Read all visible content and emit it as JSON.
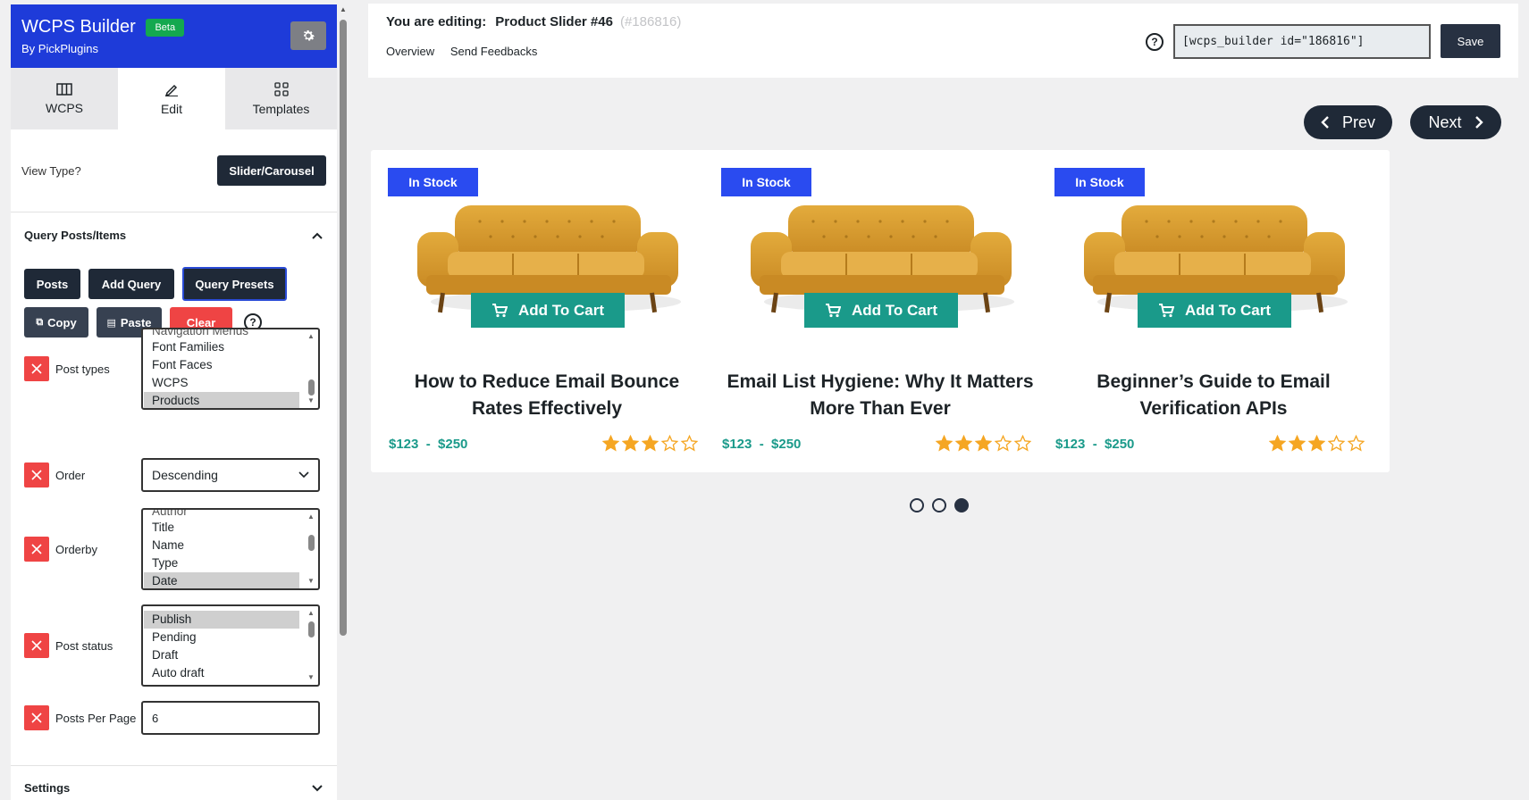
{
  "brand": {
    "title": "WCPS Builder",
    "beta": "Beta",
    "subtitle": "By PickPlugins"
  },
  "tabs": [
    {
      "label": "WCPS",
      "active": false
    },
    {
      "label": "Edit",
      "active": true
    },
    {
      "label": "Templates",
      "active": false
    }
  ],
  "view_type": {
    "label": "View Type?",
    "value": "Slider/Carousel"
  },
  "query": {
    "heading": "Query Posts/Items",
    "buttons": {
      "posts": "Posts",
      "add_query": "Add Query",
      "presets": "Query Presets",
      "copy": "Copy",
      "paste": "Paste",
      "clear": "Clear"
    },
    "fields": {
      "post_types": {
        "label": "Post types",
        "cut_option": "Navigation Menus",
        "options": [
          "Font Families",
          "Font Faces",
          "WCPS",
          "Products"
        ],
        "selected": "Products"
      },
      "order": {
        "label": "Order",
        "value": "Descending"
      },
      "orderby": {
        "label": "Orderby",
        "cut_option": "Author",
        "options": [
          "Title",
          "Name",
          "Type",
          "Date"
        ],
        "selected": "Date"
      },
      "post_status": {
        "label": "Post status",
        "options": [
          "Publish",
          "Pending",
          "Draft",
          "Auto draft"
        ],
        "selected": "Publish"
      },
      "posts_per_page": {
        "label": "Posts Per Page",
        "value": "6"
      }
    }
  },
  "settings": {
    "heading": "Settings"
  },
  "editor": {
    "editing_label": "You are editing:",
    "slider_name": "Product Slider #46",
    "slider_id": "(#186816)",
    "links": [
      "Overview",
      "Send Feedbacks"
    ],
    "shortcode": "[wcps_builder id=\"186816\"]",
    "save_label": "Save"
  },
  "slider": {
    "prev_label": "Prev",
    "next_label": "Next",
    "pages": 3,
    "active_page": 3,
    "cards": [
      {
        "badge": "In Stock",
        "cart_label": "Add To Cart",
        "title": "How to Reduce Email Bounce Rates Effectively",
        "price": "$123  -  $250",
        "rating": 3
      },
      {
        "badge": "In Stock",
        "cart_label": "Add To Cart",
        "title": "Email List Hygiene: Why It Matters More Than Ever",
        "price": "$123  -  $250",
        "rating": 3
      },
      {
        "badge": "In Stock",
        "cart_label": "Add To Cart",
        "title": "Beginner’s Guide to Email Verification APIs",
        "price": "$123  -  $250",
        "rating": 3
      }
    ]
  },
  "colors": {
    "brand": "#1e3bd9",
    "badge": "#2a4bf0",
    "teal": "#1a9a8a",
    "dark": "#1f2937",
    "danger": "#ef4444",
    "star": "#f5a623"
  }
}
